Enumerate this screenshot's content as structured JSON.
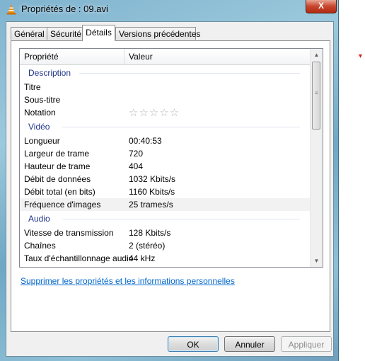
{
  "window": {
    "title": "Propriétés de : 09.avi",
    "close_glyph": "X"
  },
  "tabs": [
    {
      "label": "Général"
    },
    {
      "label": "Sécurité"
    },
    {
      "label": "Détails"
    },
    {
      "label": "Versions précédentes"
    }
  ],
  "list": {
    "col_property": "Propriété",
    "col_value": "Valeur",
    "groups": {
      "description": {
        "label": "Description",
        "rows": [
          {
            "name": "Titre",
            "value": ""
          },
          {
            "name": "Sous-titre",
            "value": ""
          },
          {
            "name": "Notation",
            "rating_stars": "☆☆☆☆☆"
          }
        ]
      },
      "video": {
        "label": "Vidéo",
        "rows": [
          {
            "name": "Longueur",
            "value": "00:40:53"
          },
          {
            "name": "Largeur de trame",
            "value": "720"
          },
          {
            "name": "Hauteur de trame",
            "value": "404"
          },
          {
            "name": "Débit de données",
            "value": "1032 Kbits/s"
          },
          {
            "name": "Débit total (en bits)",
            "value": "1160 Kbits/s"
          },
          {
            "name": "Fréquence d'images",
            "value": "25 trames/s"
          }
        ]
      },
      "audio": {
        "label": "Audio",
        "rows": [
          {
            "name": "Vitesse de transmission",
            "value": "128 Kbits/s"
          },
          {
            "name": "Chaînes",
            "value": "2 (stéréo)"
          },
          {
            "name": "Taux d'échantillonnage audio",
            "value": "44 kHz"
          }
        ]
      }
    },
    "scroll_up_glyph": "▲",
    "scroll_down_glyph": "▼",
    "scroll_grip_glyph": "≡"
  },
  "remove_link": "Supprimer les propriétés et les informations personnelles",
  "buttons": {
    "ok": "OK",
    "cancel": "Annuler",
    "apply": "Appliquer"
  },
  "outside_mark": "▾"
}
